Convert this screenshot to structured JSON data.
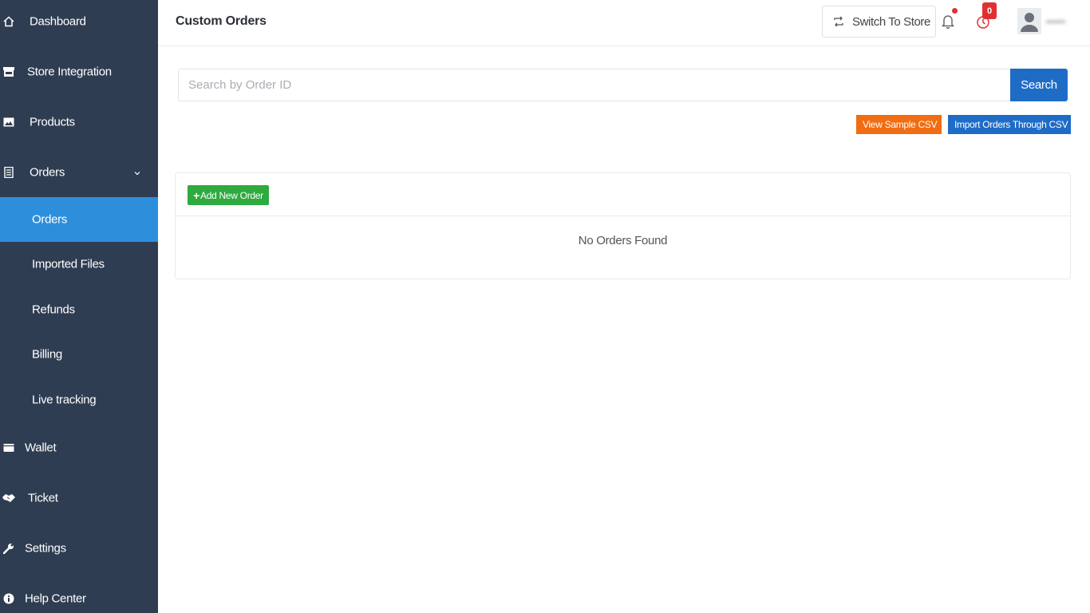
{
  "sidebar": {
    "items": [
      {
        "label": "Dashboard",
        "icon": "home-icon"
      },
      {
        "label": "Store Integration",
        "icon": "store-icon"
      },
      {
        "label": "Products",
        "icon": "image-icon"
      },
      {
        "label": "Orders",
        "icon": "orders-icon"
      },
      {
        "label": "Wallet",
        "icon": "wallet-icon"
      },
      {
        "label": "Ticket",
        "icon": "handshake-icon"
      },
      {
        "label": "Settings",
        "icon": "wrench-icon"
      },
      {
        "label": "Help Center",
        "icon": "info-icon"
      }
    ],
    "orders_submenu": [
      {
        "label": "Orders",
        "active": true
      },
      {
        "label": "Imported Files"
      },
      {
        "label": "Refunds"
      },
      {
        "label": "Billing"
      },
      {
        "label": "Live tracking"
      }
    ],
    "colors": {
      "background": "#2f3d52",
      "active": "#2d8fdc"
    }
  },
  "header": {
    "title": "Custom Orders",
    "switch_label": "Switch To Store",
    "timer_badge": "0"
  },
  "search": {
    "placeholder": "Search by Order ID",
    "value": "",
    "button_label": "Search"
  },
  "csv": {
    "sample_label": "View Sample CSV",
    "import_label": "Import Orders Through CSV"
  },
  "orders": {
    "add_label": "Add New Order",
    "empty_message": "No Orders Found"
  },
  "colors": {
    "primary": "#1f6cc7",
    "orange": "#f26c12",
    "green": "#2eaa3f",
    "alert": "#e03131"
  }
}
